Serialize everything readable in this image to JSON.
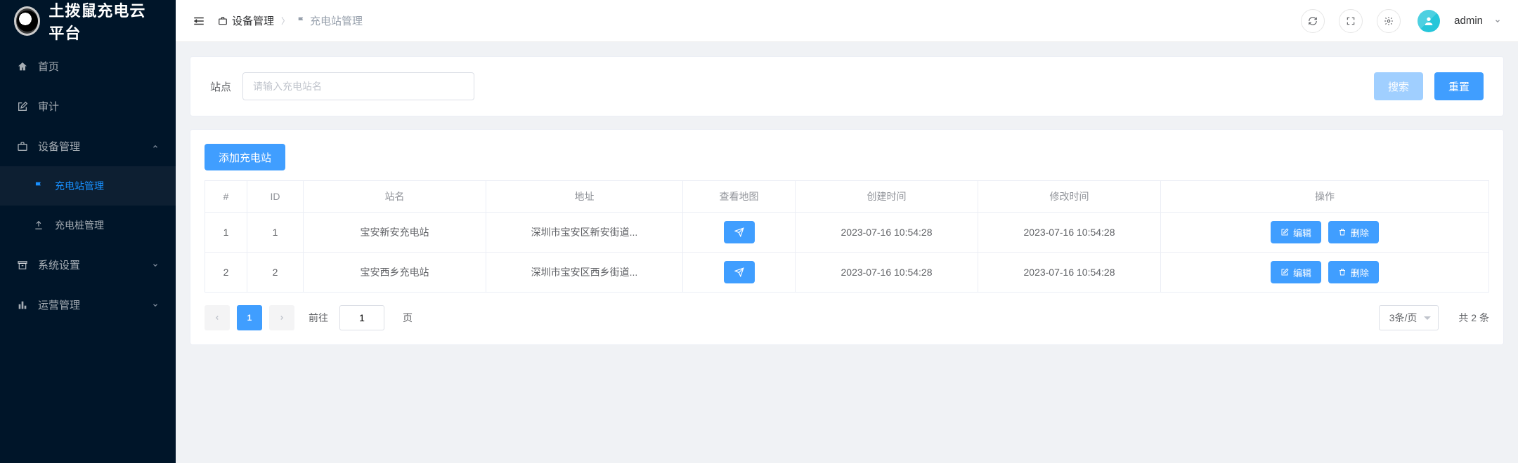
{
  "brand": "土拨鼠充电云平台",
  "sidebar": {
    "items": [
      {
        "label": "首页"
      },
      {
        "label": "审计"
      },
      {
        "label": "设备管理",
        "expanded": true,
        "children": [
          {
            "label": "充电站管理",
            "active": true
          },
          {
            "label": "充电桩管理"
          }
        ]
      },
      {
        "label": "系统设置"
      },
      {
        "label": "运营管理"
      }
    ]
  },
  "breadcrumb": {
    "root": "设备管理",
    "current": "充电站管理"
  },
  "user": {
    "name": "admin"
  },
  "search": {
    "label": "站点",
    "placeholder": "请输入充电站名",
    "submit": "搜索",
    "reset": "重置"
  },
  "toolbar": {
    "add_station": "添加充电站",
    "edit_label": "编辑",
    "delete_label": "删除"
  },
  "table": {
    "headers": [
      "#",
      "ID",
      "站名",
      "地址",
      "查看地图",
      "创建时间",
      "修改时间",
      "操作"
    ],
    "rows": [
      {
        "idx": "1",
        "id": "1",
        "name": "宝安新安充电站",
        "addr": "深圳市宝安区新安街道...",
        "created": "2023-07-16 10:54:28",
        "updated": "2023-07-16 10:54:28"
      },
      {
        "idx": "2",
        "id": "2",
        "name": "宝安西乡充电站",
        "addr": "深圳市宝安区西乡街道...",
        "created": "2023-07-16 10:54:28",
        "updated": "2023-07-16 10:54:28"
      }
    ]
  },
  "pagination": {
    "current": "1",
    "goto_prefix": "前往",
    "goto_value": "1",
    "goto_suffix": "页",
    "page_size_label": "3条/页",
    "total_text": "共 2 条"
  }
}
